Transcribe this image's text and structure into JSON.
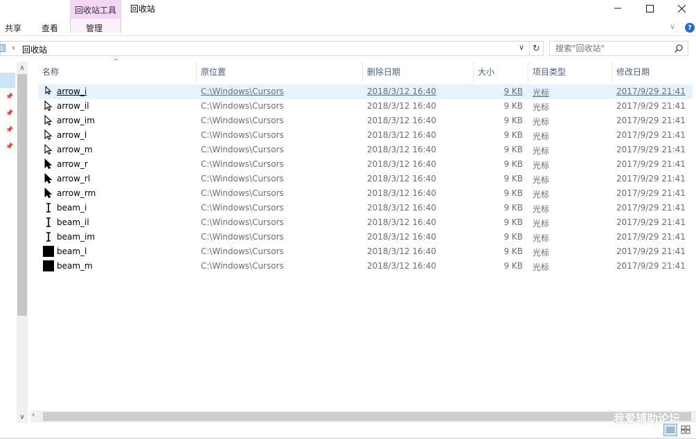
{
  "ribbon": {
    "context_tab": "回收站工具",
    "window_title": "回收站",
    "tabs": [
      {
        "label": "共享"
      },
      {
        "label": "查看"
      },
      {
        "label": "管理"
      }
    ],
    "help": "?"
  },
  "address": {
    "path": "回收站"
  },
  "search": {
    "placeholder": "搜索\"回收站\""
  },
  "columns": {
    "name": "名称",
    "location": "原位置",
    "deleted": "删除日期",
    "size": "大小",
    "type": "项目类型",
    "modified": "修改日期"
  },
  "files": [
    {
      "name": "arrow_i",
      "location": "C:\\Windows\\Cursors",
      "deleted": "2018/3/12 16:40",
      "size": "9 KB",
      "type": "光标",
      "modified": "2017/9/29 21:41",
      "icon": "arrow-small-cursor-icon",
      "selected": true
    },
    {
      "name": "arrow_il",
      "location": "C:\\Windows\\Cursors",
      "deleted": "2018/3/12 16:40",
      "size": "9 KB",
      "type": "光标",
      "modified": "2017/9/29 21:41",
      "icon": "arrow-outline-cursor-icon"
    },
    {
      "name": "arrow_im",
      "location": "C:\\Windows\\Cursors",
      "deleted": "2018/3/12 16:40",
      "size": "9 KB",
      "type": "光标",
      "modified": "2017/9/29 21:41",
      "icon": "arrow-outline-cursor-icon"
    },
    {
      "name": "arrow_l",
      "location": "C:\\Windows\\Cursors",
      "deleted": "2018/3/12 16:40",
      "size": "9 KB",
      "type": "光标",
      "modified": "2017/9/29 21:41",
      "icon": "arrow-outline-cursor-icon"
    },
    {
      "name": "arrow_m",
      "location": "C:\\Windows\\Cursors",
      "deleted": "2018/3/12 16:40",
      "size": "9 KB",
      "type": "光标",
      "modified": "2017/9/29 21:41",
      "icon": "arrow-outline-cursor-icon"
    },
    {
      "name": "arrow_r",
      "location": "C:\\Windows\\Cursors",
      "deleted": "2018/3/12 16:40",
      "size": "9 KB",
      "type": "光标",
      "modified": "2017/9/29 21:41",
      "icon": "arrow-black-cursor-icon"
    },
    {
      "name": "arrow_rl",
      "location": "C:\\Windows\\Cursors",
      "deleted": "2018/3/12 16:40",
      "size": "9 KB",
      "type": "光标",
      "modified": "2017/9/29 21:41",
      "icon": "arrow-black-cursor-icon"
    },
    {
      "name": "arrow_rm",
      "location": "C:\\Windows\\Cursors",
      "deleted": "2018/3/12 16:40",
      "size": "9 KB",
      "type": "光标",
      "modified": "2017/9/29 21:41",
      "icon": "arrow-black-cursor-icon"
    },
    {
      "name": "beam_i",
      "location": "C:\\Windows\\Cursors",
      "deleted": "2018/3/12 16:40",
      "size": "9 KB",
      "type": "光标",
      "modified": "2017/9/29 21:41",
      "icon": "ibeam-cursor-icon"
    },
    {
      "name": "beam_il",
      "location": "C:\\Windows\\Cursors",
      "deleted": "2018/3/12 16:40",
      "size": "9 KB",
      "type": "光标",
      "modified": "2017/9/29 21:41",
      "icon": "ibeam-cursor-icon"
    },
    {
      "name": "beam_im",
      "location": "C:\\Windows\\Cursors",
      "deleted": "2018/3/12 16:40",
      "size": "9 KB",
      "type": "光标",
      "modified": "2017/9/29 21:41",
      "icon": "ibeam-cursor-icon"
    },
    {
      "name": "beam_l",
      "location": "C:\\Windows\\Cursors",
      "deleted": "2018/3/12 16:40",
      "size": "9 KB",
      "type": "光标",
      "modified": "2017/9/29 21:41",
      "icon": "black-square-cursor-icon"
    },
    {
      "name": "beam_m",
      "location": "C:\\Windows\\Cursors",
      "deleted": "2018/3/12 16:40",
      "size": "9 KB",
      "type": "光标",
      "modified": "2017/9/29 21:41",
      "icon": "black-square-cursor-icon"
    }
  ],
  "watermark": "我爱辅助论坛",
  "colors": {
    "context_tab": "#f2d6f3",
    "selection": "#e5f3ff",
    "header_text": "#4c607a",
    "help": "#1f6bd1"
  }
}
